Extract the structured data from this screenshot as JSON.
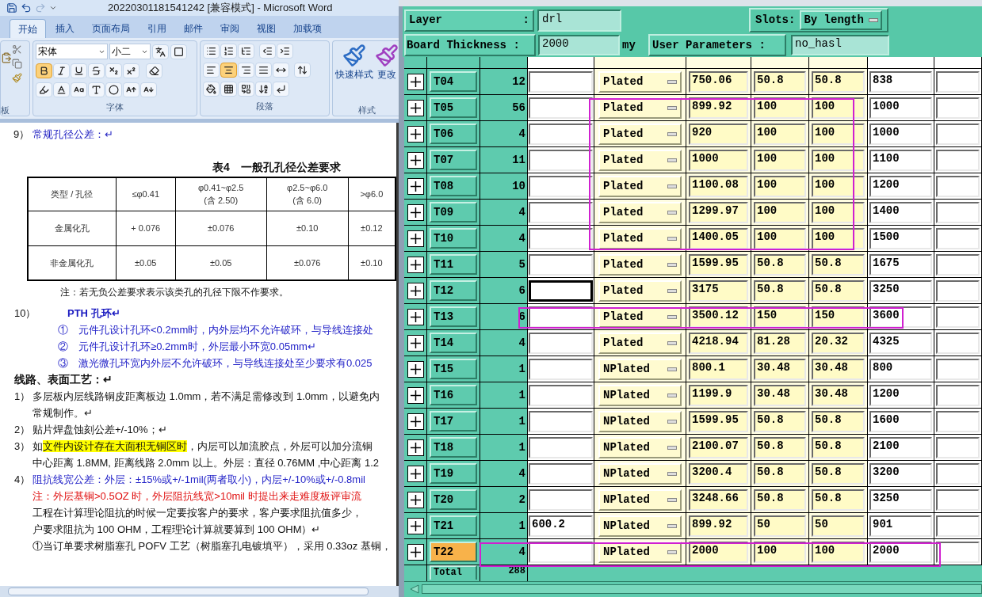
{
  "word": {
    "title": "20220301181541242 [兼容模式] - Microsoft Word",
    "tabs": [
      {
        "label": "开始",
        "selected": true
      },
      {
        "label": "插入",
        "selected": false
      },
      {
        "label": "页面布局",
        "selected": false
      },
      {
        "label": "引用",
        "selected": false
      },
      {
        "label": "邮件",
        "selected": false
      },
      {
        "label": "审阅",
        "selected": false
      },
      {
        "label": "视图",
        "selected": false
      },
      {
        "label": "加载项",
        "selected": false
      }
    ],
    "ribbon": {
      "font_name": "宋体",
      "font_size": "小二",
      "format_buttons": [
        {
          "kind": "bold",
          "selected": true
        },
        {
          "kind": "italic",
          "selected": false
        },
        {
          "kind": "underline",
          "selected": false
        },
        {
          "kind": "strike",
          "selected": false
        },
        {
          "kind": "subscript",
          "selected": false
        },
        {
          "kind": "superscript",
          "selected": false
        }
      ],
      "align_buttons": [
        {
          "kind": "left",
          "selected": false
        },
        {
          "kind": "center",
          "selected": true
        },
        {
          "kind": "right",
          "selected": false
        },
        {
          "kind": "justify",
          "selected": false
        },
        {
          "kind": "distributed",
          "selected": false
        }
      ],
      "groups": [
        "板",
        "字体",
        "段落",
        "样式"
      ],
      "styles": [
        "快速样式",
        "更改"
      ]
    },
    "document": {
      "item_9": {
        "number": "9）",
        "text": "常规孔径公差：↵"
      },
      "table": {
        "title": "表4　一般孔孔径公差要求",
        "header": [
          "类型 / 孔径",
          "≤φ0.41",
          "φ0.41~φ2.5\n(含 2.50)",
          "φ2.5~φ6.0\n(含 6.0)",
          ">φ6.0"
        ],
        "rows": [
          [
            "金属化孔",
            "+ 0.076",
            "±0.076",
            "±0.10",
            "±0.12"
          ],
          [
            "非金属化孔",
            "±0.05",
            "±0.05",
            "±0.076",
            "±0.10"
          ]
        ]
      },
      "table_note": "注：若无负公差要求表示该类孔的孔径下限不作要求。",
      "lines": [
        {
          "kind": "heading",
          "number": "10）",
          "segments": [
            {
              "text": "PTH 孔环↵",
              "highlight": false
            }
          ]
        },
        {
          "kind": "sub",
          "segments": [
            {
              "text": "①　元件孔设计孔环<0.2mm时，内外层均不允许破环，与导线连接处",
              "highlight": false
            }
          ]
        },
        {
          "kind": "sub",
          "segments": [
            {
              "text": "②　元件孔设计孔环≥0.2mm时，外层最小环宽0.05mm↵",
              "highlight": false
            }
          ]
        },
        {
          "kind": "sub",
          "segments": [
            {
              "text": "③　激光微孔环宽内外层不允许破环，与导线连接处至少要求有0.025",
              "highlight": false
            }
          ]
        },
        {
          "kind": "section",
          "segments": [
            {
              "text": "线路、表面工艺：↵",
              "highlight": false
            }
          ]
        },
        {
          "kind": "item",
          "number": "1）",
          "segments": [
            {
              "text": "多层板内层线路铜皮距离板边 1.0mm，若不满足需修改到 1.0mm，以避免内",
              "highlight": false
            }
          ]
        },
        {
          "kind": "continuation",
          "segments": [
            {
              "text": "常规制作。↵",
              "highlight": false
            }
          ]
        },
        {
          "kind": "item",
          "number": "2）",
          "segments": [
            {
              "text": "贴片焊盘蚀刻公差+/-10%；↵",
              "highlight": false
            }
          ]
        },
        {
          "kind": "item",
          "number": "3）",
          "segments": [
            {
              "text": "如",
              "highlight": false
            },
            {
              "text": "文件内设计存在大面积无铜区时",
              "highlight": true
            },
            {
              "text": "，内层可以加流胶点，外层可以加分流铜",
              "highlight": false
            }
          ]
        },
        {
          "kind": "continuation",
          "segments": [
            {
              "text": "中心距离 1.8MM, 距离线路 2.0mm 以上。外层：直径 0.76MM ,中心距离 1.2",
              "highlight": false
            }
          ]
        },
        {
          "kind": "item-blue",
          "number": "4）",
          "segments": [
            {
              "text": "阻抗线宽公差：外层：±15%或+/-1mil(两者取小)，内层+/-10%或+/-0.8mil",
              "highlight": false
            }
          ]
        },
        {
          "kind": "note-red",
          "segments": [
            {
              "text": "注：外层基铜>0.5OZ 时，外层阻抗线宽>10mil 时提出来走难度板评审流",
              "highlight": false
            }
          ]
        },
        {
          "kind": "continuation",
          "segments": [
            {
              "text": "工程在计算理论阻抗的时候一定要按客户的要求，客户要求阻抗值多少，",
              "highlight": false
            }
          ]
        },
        {
          "kind": "continuation",
          "segments": [
            {
              "text": "户要求阻抗为 100 OHM，工程理论计算就要算到 100 OHM）↵",
              "highlight": false
            }
          ]
        },
        {
          "kind": "continuation",
          "segments": [
            {
              "text": "①当订单要求树脂塞孔 POFV 工艺（树脂塞孔电镀填平），采用 0.33oz 基铜，",
              "highlight": false
            }
          ]
        }
      ]
    }
  },
  "tool": {
    "layer_label": "Layer",
    "layer_colon": ":",
    "layer": "drl",
    "slots_label": "Slots:",
    "slots": "By length",
    "thickness_label": "Board Thickness :",
    "thickness": "2000",
    "thickness_unit": "my",
    "params_label": "User Parameters :",
    "params": "no_hasl",
    "rows": [
      {
        "name": "T04",
        "count": "12",
        "type": "Plated",
        "column_5": "750.06",
        "column_6": "50.8",
        "column_7": "50.8",
        "column_8": "838",
        "selected": false,
        "focused": false
      },
      {
        "name": "T05",
        "count": "56",
        "type": "Plated",
        "column_5": "899.92",
        "column_6": "100",
        "column_7": "100",
        "column_8": "1000",
        "selected": false,
        "focused": false
      },
      {
        "name": "T06",
        "count": "4",
        "type": "Plated",
        "column_5": "920",
        "column_6": "100",
        "column_7": "100",
        "column_8": "1000",
        "selected": false,
        "focused": false
      },
      {
        "name": "T07",
        "count": "11",
        "type": "Plated",
        "column_5": "1000",
        "column_6": "100",
        "column_7": "100",
        "column_8": "1100",
        "selected": false,
        "focused": false
      },
      {
        "name": "T08",
        "count": "10",
        "type": "Plated",
        "column_5": "1100.08",
        "column_6": "100",
        "column_7": "100",
        "column_8": "1200",
        "selected": false,
        "focused": false
      },
      {
        "name": "T09",
        "count": "4",
        "type": "Plated",
        "column_5": "1299.97",
        "column_6": "100",
        "column_7": "100",
        "column_8": "1400",
        "selected": false,
        "focused": false
      },
      {
        "name": "T10",
        "count": "4",
        "type": "Plated",
        "column_5": "1400.05",
        "column_6": "100",
        "column_7": "100",
        "column_8": "1500",
        "selected": false,
        "focused": false
      },
      {
        "name": "T11",
        "count": "5",
        "type": "Plated",
        "column_5": "1599.95",
        "column_6": "50.8",
        "column_7": "50.8",
        "column_8": "1675",
        "selected": false,
        "focused": false
      },
      {
        "name": "T12",
        "count": "6",
        "type": "Plated",
        "column_5": "3175",
        "column_6": "50.8",
        "column_7": "50.8",
        "column_8": "3250",
        "selected": false,
        "focused": true
      },
      {
        "name": "T13",
        "count": "6",
        "type": "Plated",
        "column_5": "3500.12",
        "column_6": "150",
        "column_7": "150",
        "column_8": "3600",
        "selected": false,
        "focused": false
      },
      {
        "name": "T14",
        "count": "4",
        "type": "Plated",
        "column_5": "4218.94",
        "column_6": "81.28",
        "column_7": "20.32",
        "column_8": "4325",
        "selected": false,
        "focused": false
      },
      {
        "name": "T15",
        "count": "1",
        "type": "NPlated",
        "column_5": "800.1",
        "column_6": "30.48",
        "column_7": "30.48",
        "column_8": "800",
        "selected": false,
        "focused": false
      },
      {
        "name": "T16",
        "count": "1",
        "type": "NPlated",
        "column_5": "1199.9",
        "column_6": "30.48",
        "column_7": "30.48",
        "column_8": "1200",
        "selected": false,
        "focused": false
      },
      {
        "name": "T17",
        "count": "1",
        "type": "NPlated",
        "column_5": "1599.95",
        "column_6": "50.8",
        "column_7": "50.8",
        "column_8": "1600",
        "selected": false,
        "focused": false
      },
      {
        "name": "T18",
        "count": "1",
        "type": "NPlated",
        "column_5": "2100.07",
        "column_6": "50.8",
        "column_7": "50.8",
        "column_8": "2100",
        "selected": false,
        "focused": false
      },
      {
        "name": "T19",
        "count": "4",
        "type": "NPlated",
        "column_5": "3200.4",
        "column_6": "50.8",
        "column_7": "50.8",
        "column_8": "3200",
        "selected": false,
        "focused": false
      },
      {
        "name": "T20",
        "count": "2",
        "type": "NPlated",
        "column_5": "3248.66",
        "column_6": "50.8",
        "column_7": "50.8",
        "column_8": "3250",
        "selected": false,
        "focused": false
      },
      {
        "name": "T21",
        "count": "1",
        "column_3": "600.2",
        "type": "NPlated",
        "column_5": "899.92",
        "column_6": "50",
        "column_7": "50",
        "column_8": "901",
        "selected": false,
        "focused": false
      },
      {
        "name": "T22",
        "count": "4",
        "type": "NPlated",
        "column_5": "2000",
        "column_6": "100",
        "column_7": "100",
        "column_8": "2000",
        "selected": true,
        "focused": false
      }
    ],
    "total": {
      "name": "Total",
      "count": "288"
    }
  }
}
